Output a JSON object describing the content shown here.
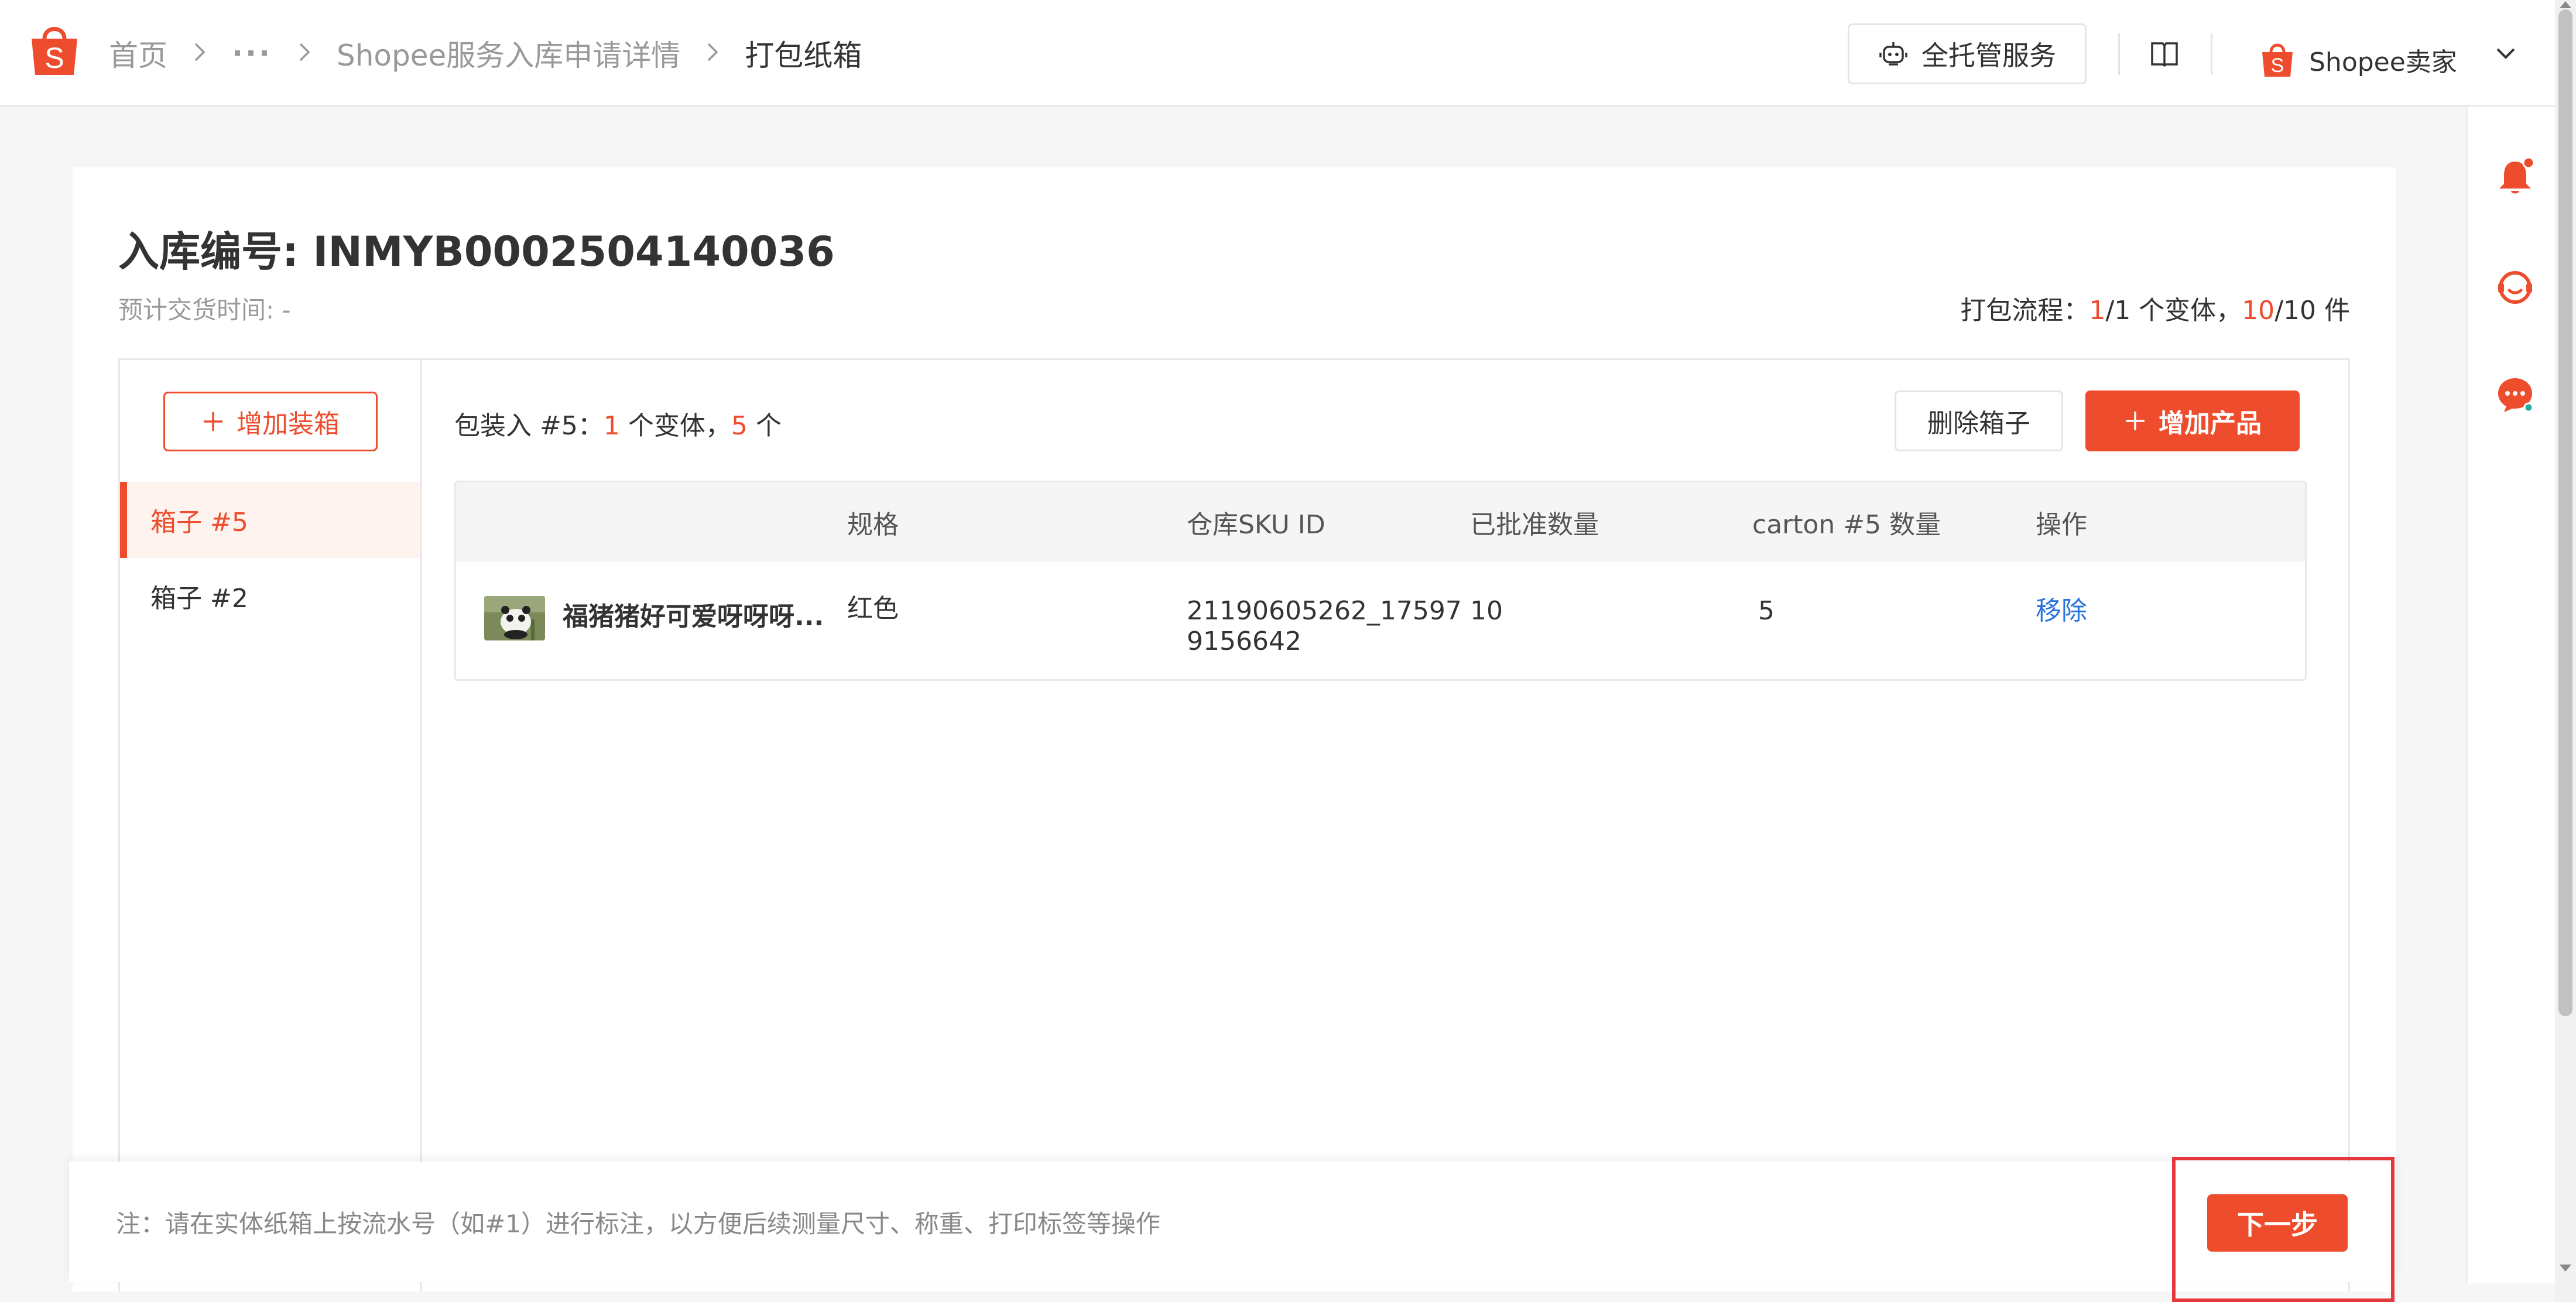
{
  "breadcrumb": {
    "home": "首页",
    "ellipsis": "···",
    "parent": "Shopee服务入库申请详情",
    "current": "打包纸箱"
  },
  "header": {
    "service_label": "全托管服务",
    "seller_label": "Shopee卖家"
  },
  "page": {
    "title": "入库编号: INMYB0002504140036",
    "eta_label": "预计交货时间: -",
    "progress": {
      "prefix": "打包流程：",
      "variant_done": "1",
      "variant_rest": "/1 个变体，",
      "items_done": "10",
      "items_rest": "/10 件"
    }
  },
  "sidebar": {
    "add_box_label": "增加装箱",
    "boxes": [
      {
        "label": "箱子 #5",
        "active": true
      },
      {
        "label": "箱子 #2",
        "active": false
      }
    ]
  },
  "pack": {
    "prefix": "包装入 #5：",
    "variants": "1",
    "mid": " 个变体，",
    "qty": "5",
    "suffix": " 个",
    "delete_label": "删除箱子",
    "add_product_label": "增加产品"
  },
  "table": {
    "headers": [
      "规格",
      "仓库SKU ID",
      "已批准数量",
      "carton #5 数量",
      "操作"
    ],
    "rows": [
      {
        "product": "福猪猪好可爱呀呀呀...",
        "spec": "红色",
        "sku_line1": "21190605262_17597",
        "sku_line2": "9156642",
        "approved": "10",
        "carton_qty": "5",
        "action": "移除"
      }
    ]
  },
  "footer": {
    "note": "注：请在实体纸箱上按流水号（如#1）进行标注，以方便后续测量尺寸、称重、打印标签等操作",
    "next_label": "下一步"
  },
  "colors": {
    "accent": "#ee4d2d",
    "link": "#2673dd",
    "highlight": "#e4393c"
  },
  "icons": [
    "shopee-logo-icon",
    "chevron-right-icon",
    "robot-service-icon",
    "book-icon",
    "shopee-bag-icon",
    "chevron-down-icon",
    "bell-icon",
    "support-headset-icon",
    "chat-bubble-icon",
    "plus-icon"
  ]
}
